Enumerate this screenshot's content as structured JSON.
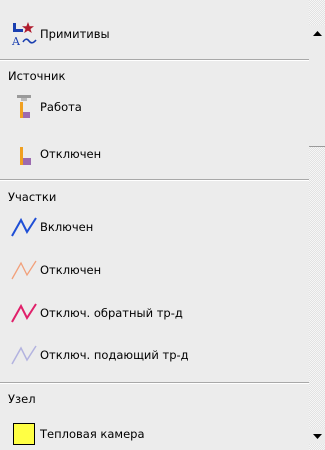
{
  "title_item": {
    "label": "Примитивы",
    "icon": "primitives-icon"
  },
  "sections": {
    "source": {
      "header": "Источник",
      "items": [
        {
          "label": "Работа",
          "icon": "source-working-icon"
        },
        {
          "label": "Отключен",
          "icon": "source-disabled-icon"
        }
      ]
    },
    "segments": {
      "header": "Участки",
      "items": [
        {
          "label": "Включен",
          "icon": "segment-on-icon",
          "color": "#1f4fd6"
        },
        {
          "label": "Отключен",
          "icon": "segment-off-icon",
          "color": "#f2a07a"
        },
        {
          "label": "Отключ. обратный тр-д",
          "icon": "segment-return-off-icon",
          "color": "#e0206a"
        },
        {
          "label": "Отключ. подающий тр-д",
          "icon": "segment-supply-off-icon",
          "color": "#b3b3e0"
        }
      ]
    },
    "node": {
      "header": "Узел",
      "items": [
        {
          "label": "Тепловая камера",
          "icon": "heat-chamber-icon",
          "color": "#ffff44"
        }
      ]
    }
  },
  "colors": {
    "panel_bg": "#ececec",
    "source_orange": "#f0a020",
    "source_purple": "#9c6ab0",
    "source_gray": "#9a9a9a"
  }
}
